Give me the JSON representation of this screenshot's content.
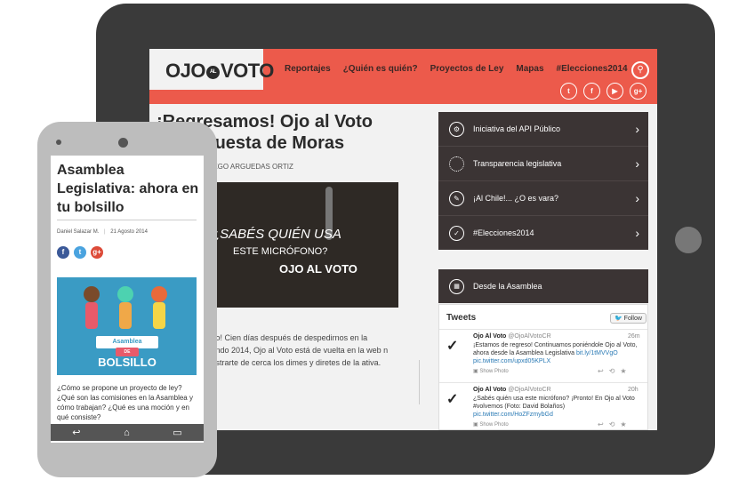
{
  "tablet": {
    "logo": {
      "part1": "OJO",
      "al": "AL",
      "part2": "VOTO"
    },
    "nav": [
      "Reportajes",
      "¿Quién es quién?",
      "Proyectos de Ley",
      "Mapas",
      "#Elecciones2014"
    ],
    "social": [
      "twitter-icon",
      "facebook-icon",
      "youtube-icon",
      "google-plus-icon"
    ],
    "article": {
      "title": "¡Regresamos! Ojo al Voto en la Cuesta de Moras",
      "byline": "M., DIEGO ARGUEDAS ORTIZ",
      "hero": {
        "line1": "¿SABÉS QUIÉN USA",
        "line2": "ESTE MICRÓFONO?",
        "line3": "OJO AL VOTO"
      },
      "body": "reso! Cien días después de despedirnos en la Mando 2014, Ojo al Voto está de vuelta en la web n mostrarte de cerca los dimes y diretes de la ativa."
    },
    "sidebar": [
      {
        "label": "Iniciativa del API Público",
        "icon": "api-icon"
      },
      {
        "label": "Transparencia legislativa",
        "icon": "transparency-icon"
      },
      {
        "label": "¡Al Chile!... ¿O es vara?",
        "icon": "chile-icon"
      },
      {
        "label": "#Elecciones2014",
        "icon": "check-icon"
      }
    ],
    "asamblea": "Desde la Asamblea",
    "tweets": {
      "heading": "Tweets",
      "follow": "Follow",
      "items": [
        {
          "name": "Ojo Al Voto",
          "handle": "@OjoAlVotoCR",
          "time": "26m",
          "text": "¡Estamos de regreso! Continuamos poniéndole Ojo al Voto, ahora desde la Asamblea Legislativa",
          "link": "bit.ly/1tMVVgO pic.twitter.com/upxd05KPLX",
          "photo": "Show Photo"
        },
        {
          "name": "Ojo Al Voto",
          "handle": "@OjoAlVotoCR",
          "time": "20h",
          "text": "¿Sabés quién usa este micrófono? ¡Pronto! En Ojo al Voto #volvemos (Foto: David Bolaños)",
          "link": "pic.twitter.com/HoZFzmybGd",
          "photo": "Show Photo"
        }
      ]
    }
  },
  "phone": {
    "title": "Asamblea Legislativa: ahora en tu bolsillo",
    "author": "Daniel Salazar M.",
    "date": "21 Agosto 2014",
    "social": [
      "facebook-icon",
      "twitter-icon",
      "google-plus-icon"
    ],
    "image": {
      "banner1": "Asamblea",
      "banner2": "DE",
      "banner3": "BOLSILLO"
    },
    "body": "¿Cómo se propone un proyecto de ley? ¿Qué son las comisiones en la Asamblea y cómo trabajan? ¿Qué es una moción y en qué consiste?"
  },
  "colors": {
    "brand": "#ec5a4b",
    "sidebar": "#3b3434",
    "phone_image": "#3a9bc4"
  }
}
